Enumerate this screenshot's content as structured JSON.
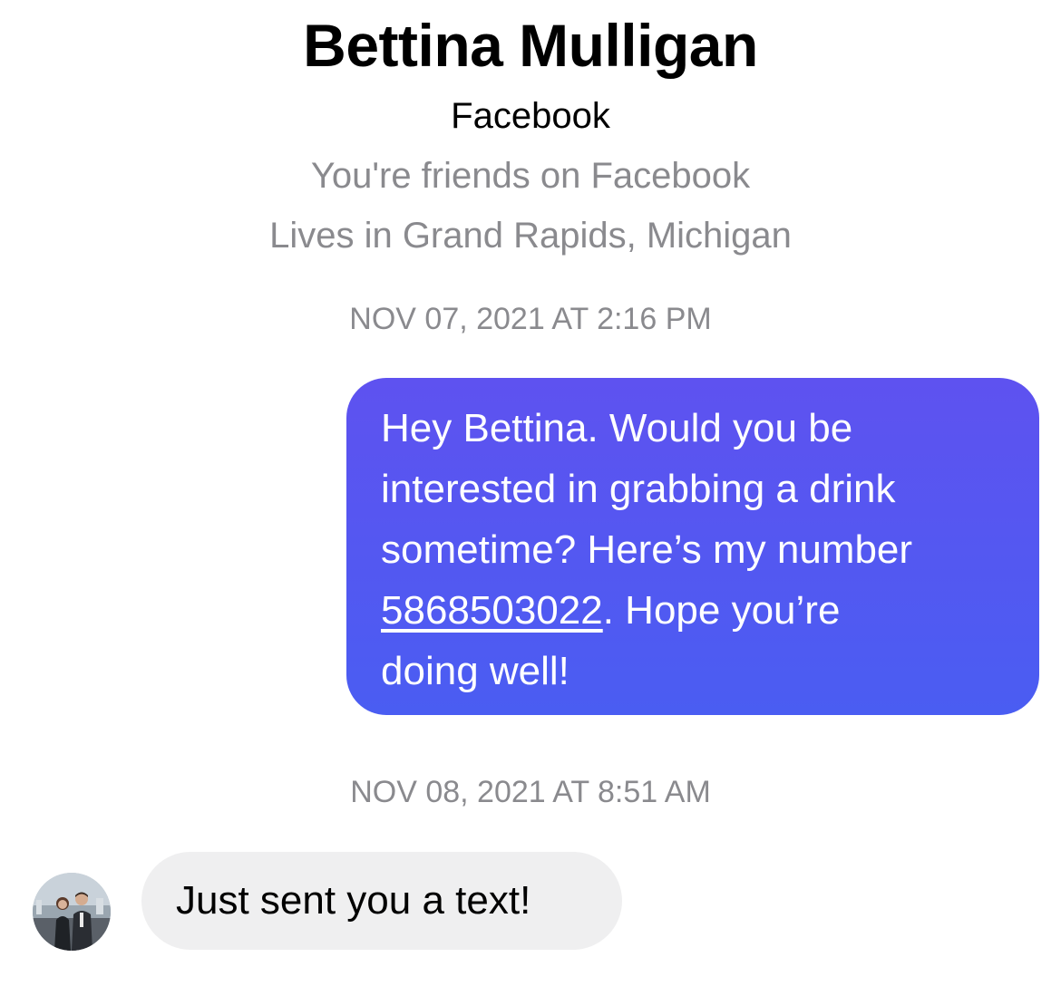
{
  "profile": {
    "name": "Bettina Mulligan",
    "platform": "Facebook",
    "friendship": "You're friends on Facebook",
    "location": "Lives in Grand Rapids, Michigan"
  },
  "messages": [
    {
      "timestamp": "NOV 07, 2021 AT 2:16 PM",
      "direction": "outgoing",
      "lines": [
        "Hey Bettina. Would you be",
        "interested in grabbing a drink",
        "sometime? Here’s my number"
      ],
      "phone": "5868503022",
      "after_phone": ". Hope you’re",
      "last_line": "doing well!"
    },
    {
      "timestamp": "NOV 08, 2021 AT 8:51 AM",
      "direction": "incoming",
      "text": "Just sent you a text!"
    }
  ],
  "colors": {
    "outgoing_bubble_top": "#5e52f0",
    "outgoing_bubble_bottom": "#4a5df2",
    "incoming_bubble": "#efeff0",
    "meta_text": "#8a8a8e"
  },
  "icons": {
    "avatar": "avatar-photo"
  }
}
